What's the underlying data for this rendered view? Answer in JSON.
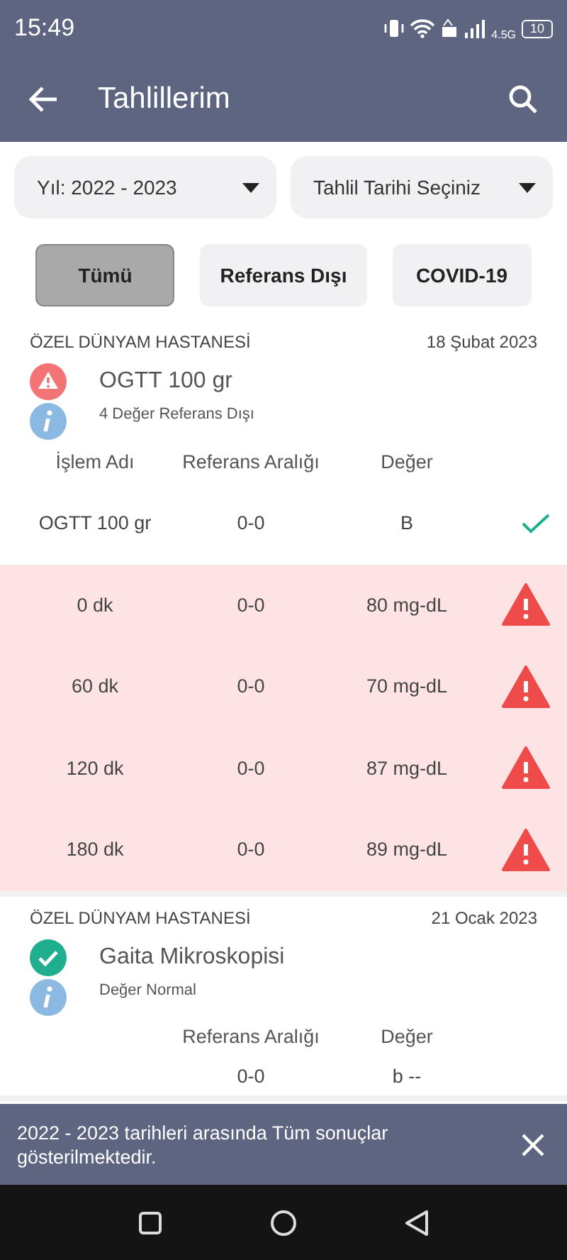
{
  "status_bar": {
    "time": "15:49",
    "network": "4.5G",
    "battery": "10"
  },
  "app_bar": {
    "title": "Tahlillerim"
  },
  "dropdowns": [
    {
      "label": "Yıl: 2022 - 2023"
    },
    {
      "label": "Tahlil Tarihi Seçiniz"
    }
  ],
  "filters": [
    {
      "label": "Tümü",
      "selected": true
    },
    {
      "label": "Referans Dışı",
      "selected": false
    },
    {
      "label": "COVID-19",
      "selected": false
    }
  ],
  "cards": [
    {
      "hospital": "ÖZEL DÜNYAM HASTANESİ",
      "date": "18 Şubat 2023",
      "kind": "alert",
      "title": "OGTT 100 gr",
      "info": "4 Değer Referans Dışı",
      "columns": [
        "İşlem Adı",
        "Referans Aralığı",
        "Değer"
      ],
      "rows": [
        {
          "kind": "normal",
          "name": "OGTT 100 gr",
          "range": "0-0",
          "value": "B"
        },
        {
          "kind": "out",
          "name": "0 dk",
          "range": "0-0",
          "value": "80 mg-dL"
        },
        {
          "kind": "out",
          "name": "60 dk",
          "range": "0-0",
          "value": "70 mg-dL"
        },
        {
          "kind": "out",
          "name": "120 dk",
          "range": "0-0",
          "value": "87 mg-dL"
        },
        {
          "kind": "out",
          "name": "180 dk",
          "range": "0-0",
          "value": "89 mg-dL"
        }
      ]
    },
    {
      "hospital": "ÖZEL DÜNYAM HASTANESİ",
      "date": "21 Ocak 2023",
      "kind": "ok",
      "title": "Gaita Mikroskopisi",
      "info": "Değer Normal",
      "columns": [
        "Referans Aralığı",
        "Değer"
      ],
      "rows": [
        {
          "kind": "plain",
          "range": "0-0",
          "value": "b --"
        }
      ]
    }
  ],
  "snackbar": {
    "message": "2022 - 2023 tarihleri arasında Tüm sonuçlar gösterilmektedir."
  }
}
